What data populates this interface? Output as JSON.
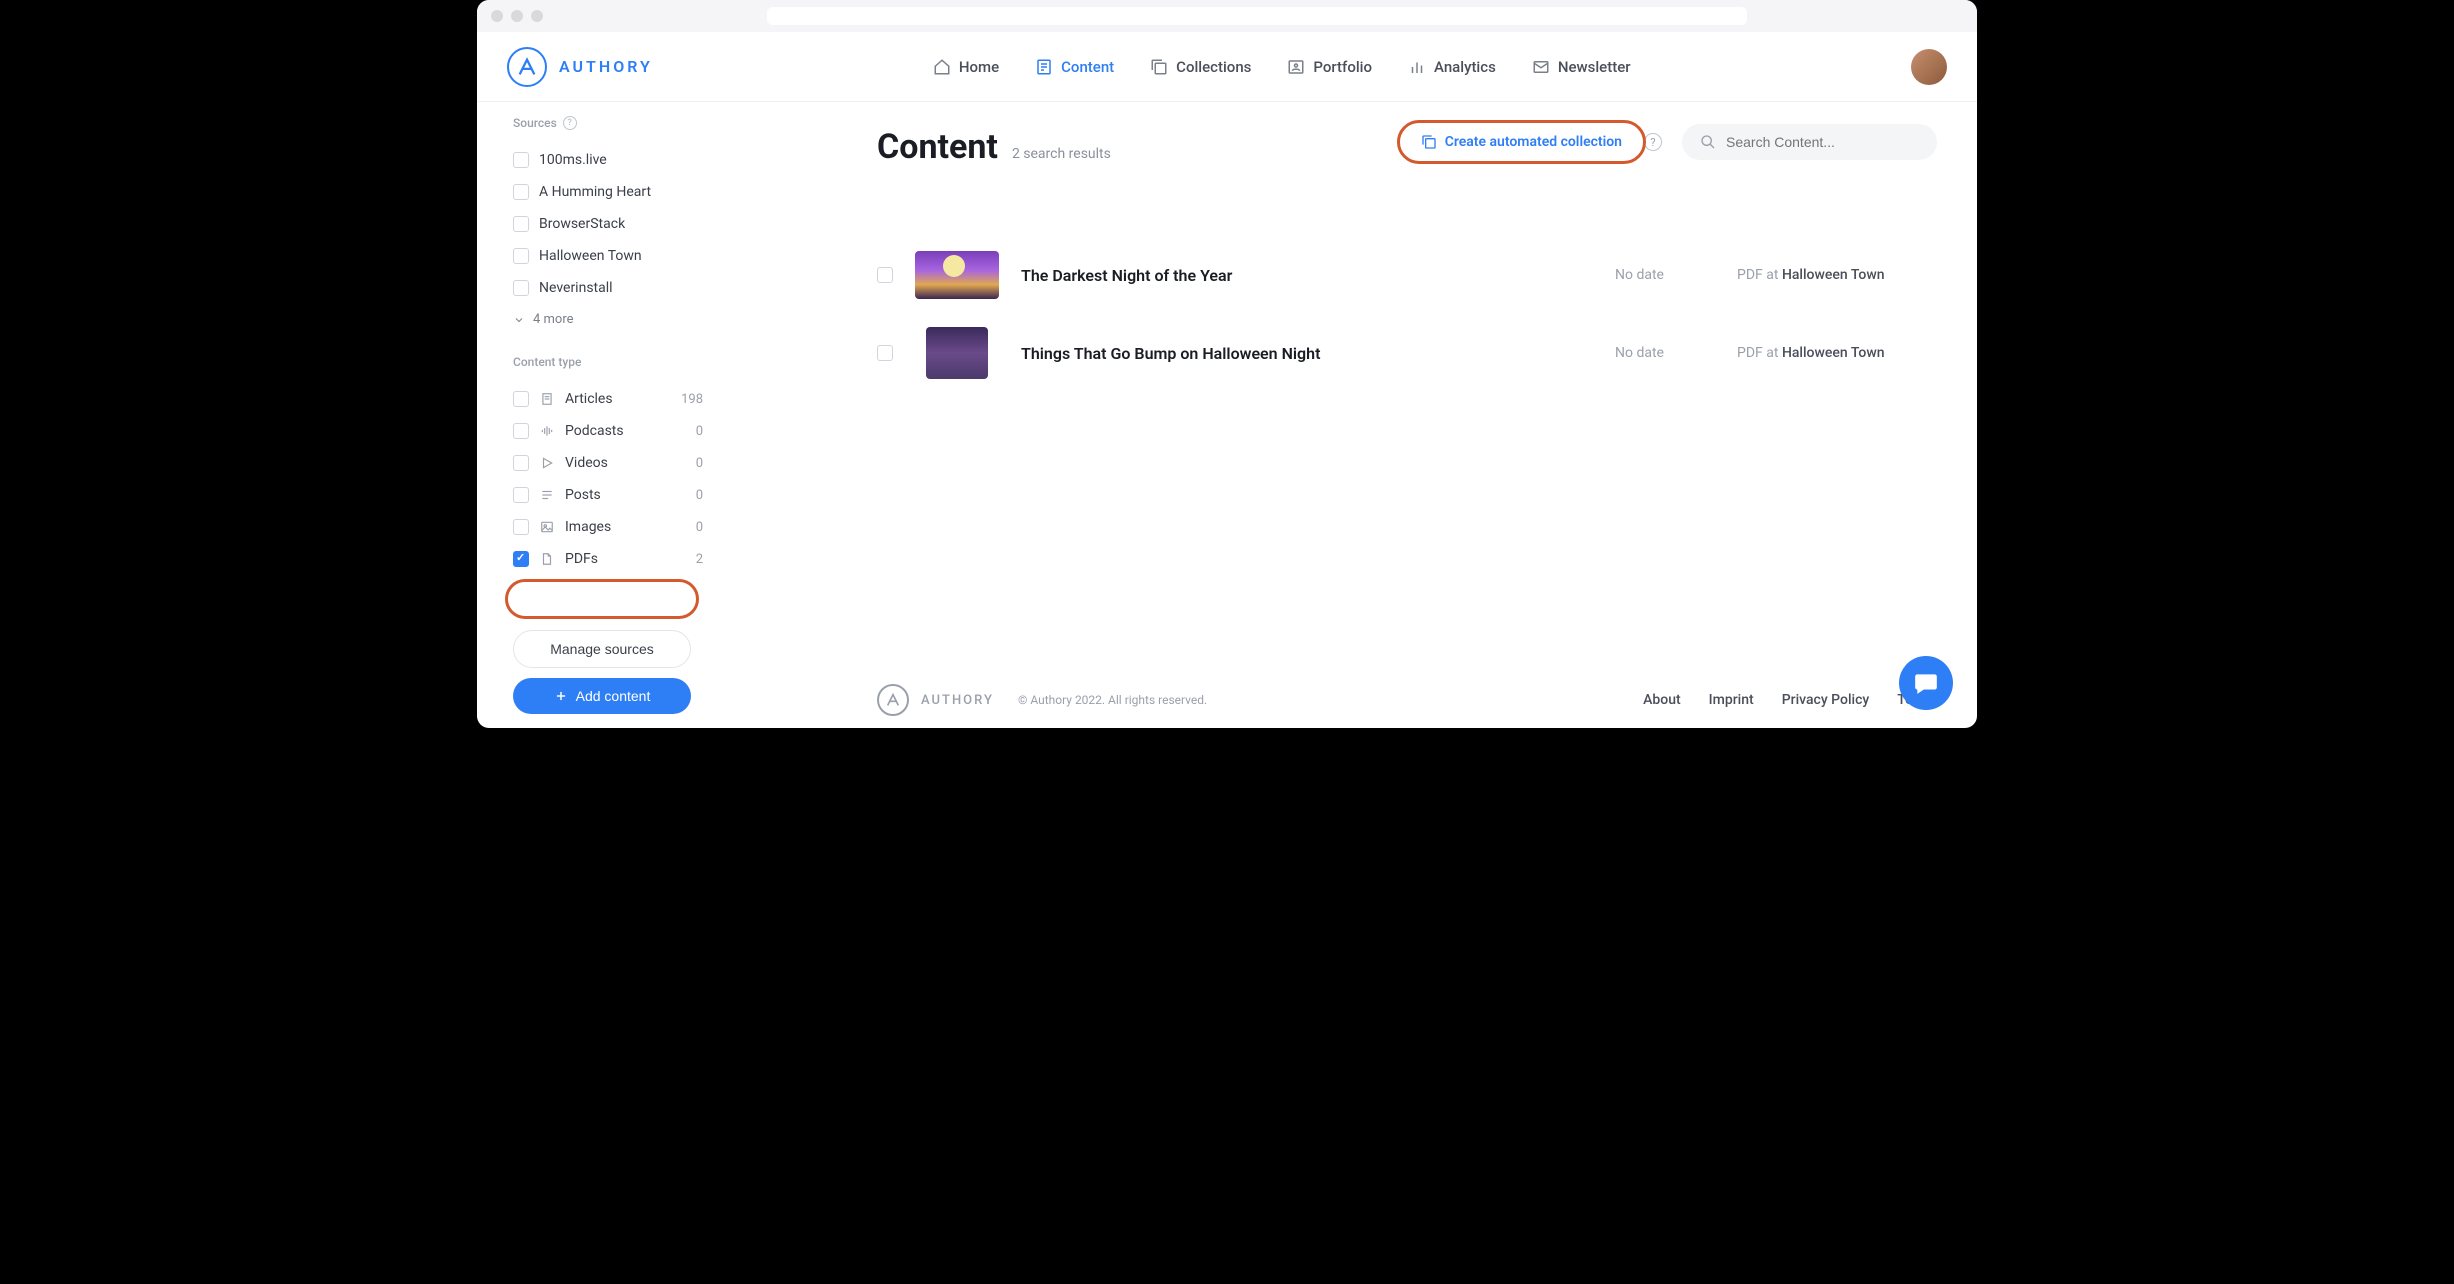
{
  "brand": {
    "name": "AUTHORY"
  },
  "nav": {
    "home": "Home",
    "content": "Content",
    "collections": "Collections",
    "portfolio": "Portfolio",
    "analytics": "Analytics",
    "newsletter": "Newsletter"
  },
  "page": {
    "title": "Content",
    "subtitle": "2 search results",
    "autoCollection": "Create automated collection",
    "searchPlaceholder": "Search Content..."
  },
  "sidebar": {
    "sourcesLabel": "Sources",
    "sources": [
      {
        "label": "100ms.live",
        "checked": false
      },
      {
        "label": "A Humming Heart",
        "checked": false
      },
      {
        "label": "BrowserStack",
        "checked": false
      },
      {
        "label": "Halloween Town",
        "checked": false
      },
      {
        "label": "Neverinstall",
        "checked": false
      }
    ],
    "moreLabel": "4 more",
    "contentTypeLabel": "Content type",
    "types": [
      {
        "label": "Articles",
        "count": "198",
        "checked": false,
        "icon": "article"
      },
      {
        "label": "Podcasts",
        "count": "0",
        "checked": false,
        "icon": "podcast"
      },
      {
        "label": "Videos",
        "count": "0",
        "checked": false,
        "icon": "video"
      },
      {
        "label": "Posts",
        "count": "0",
        "checked": false,
        "icon": "post"
      },
      {
        "label": "Images",
        "count": "0",
        "checked": false,
        "icon": "image"
      },
      {
        "label": "PDFs",
        "count": "2",
        "checked": true,
        "icon": "pdf"
      }
    ],
    "manage": "Manage sources",
    "add": "Add content"
  },
  "items": [
    {
      "title": "The Darkest Night of the Year",
      "date": "No date",
      "type": "PDF",
      "at": "at",
      "publication": "Halloween Town"
    },
    {
      "title": "Things That Go Bump on Halloween Night",
      "date": "No date",
      "type": "PDF",
      "at": "at",
      "publication": "Halloween Town"
    }
  ],
  "footer": {
    "brand": "AUTHORY",
    "copy": "© Authory 2022. All rights reserved.",
    "links": {
      "about": "About",
      "imprint": "Imprint",
      "privacy": "Privacy Policy",
      "terms": "Terms"
    }
  }
}
